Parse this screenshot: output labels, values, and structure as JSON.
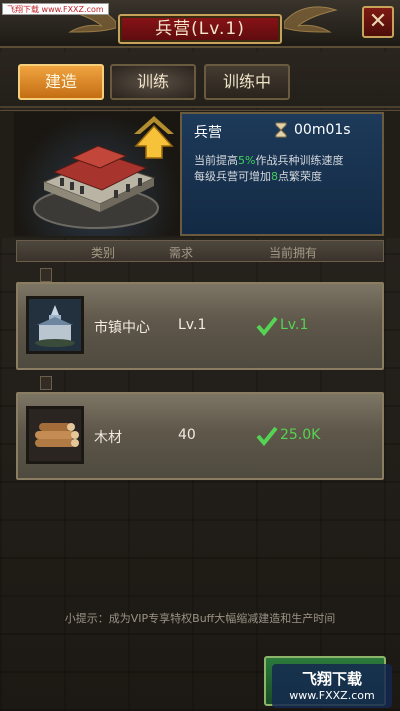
{
  "watermark_top": "飞翔下载 www.FXXZ.com",
  "header": {
    "title": "兵营(Lv.1)",
    "close_label": "✕"
  },
  "tabs": [
    {
      "label": "建造",
      "state": "active"
    },
    {
      "label": "训练",
      "state": "glow"
    },
    {
      "label": "训练中",
      "state": "normal"
    }
  ],
  "building": {
    "name": "兵营",
    "timer": "00m01s",
    "desc1_pre": "当前提高",
    "desc1_val": "5%",
    "desc1_post": "作战兵种训练速度",
    "desc2_pre": "每级兵营可增加",
    "desc2_val": "8",
    "desc2_post": "点繁荣度"
  },
  "table": {
    "headers": [
      "类别",
      "需求",
      "当前拥有"
    ],
    "rows": [
      {
        "name": "市镇中心",
        "req": "Lv.1",
        "have": "Lv.1",
        "icon": "town-center-icon"
      },
      {
        "name": "木材",
        "req": "40",
        "have": "25.0K",
        "icon": "wood-icon"
      }
    ]
  },
  "tip": "小提示：成为VIP专享特权Buff大幅缩减建造和生产时间",
  "watermark_br": {
    "line1": "飞翔下载",
    "line2": "www.FXXZ.com"
  },
  "colors": {
    "accent": "#f0a440",
    "ok": "#55d352",
    "title_plate": "#8a1418"
  }
}
